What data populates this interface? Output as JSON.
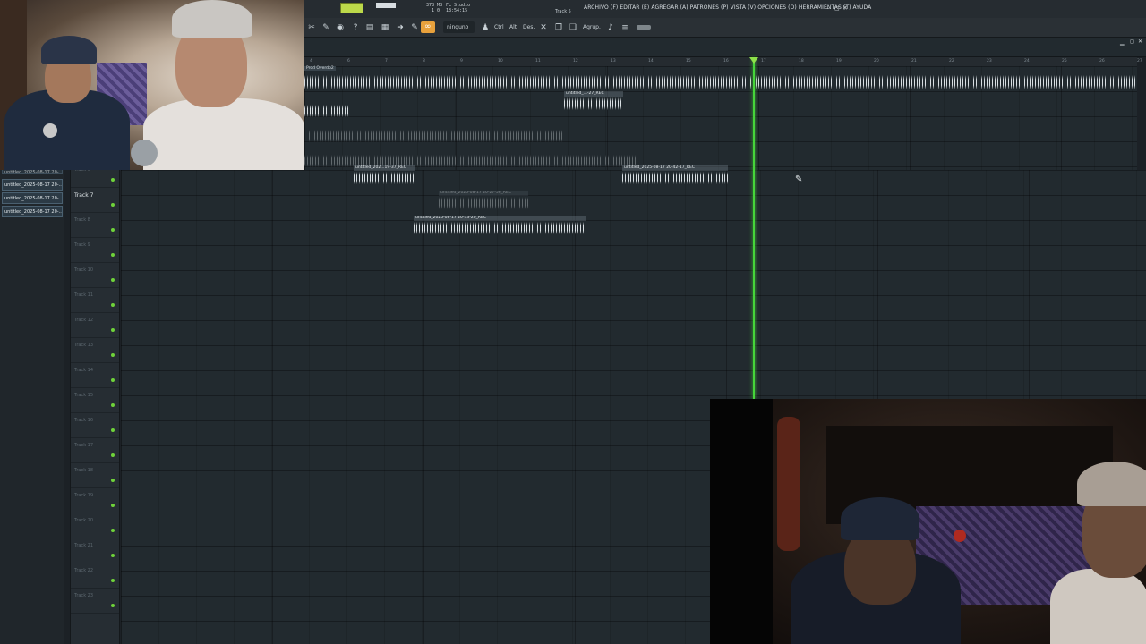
{
  "window": {
    "menu": "ARCHIVO (F) EDITAR (E) AGREGAR (A) PATRONES (P) VISTA (V) OPCIONES (O) HERRAMIENTAS (T) AYUDA",
    "track_label": "Track 5",
    "app_name": "FL Studio",
    "memory": "378 MB",
    "time": "18:54:15",
    "ratio": "1 0",
    "controls": [
      "–",
      "◻",
      "✕"
    ]
  },
  "toolbar": {
    "snap_label": "ninguno",
    "ctrl_label": "Ctrl",
    "alt_label": "Alt",
    "des_label": "Des.",
    "agrup_label": "Agrup."
  },
  "ruler": {
    "marks": [
      "4",
      "6",
      "7",
      "8",
      "9",
      "10",
      "11",
      "12",
      "13",
      "14",
      "15",
      "16",
      "17",
      "18",
      "19",
      "20",
      "21",
      "22",
      "23",
      "24",
      "25",
      "26",
      "27"
    ]
  },
  "playlist_header": "Prod Overdp2",
  "browser": {
    "items": [
      "untitled_2025-08-17 20-...",
      "untitled_2025-08-17 20-...",
      "untitled_2025-08-17 20-...",
      "untitled_2025-08-17 20-..."
    ]
  },
  "tracks": [
    {
      "name": "Track 6",
      "active": false
    },
    {
      "name": "Track 7",
      "active": true
    },
    {
      "name": "Track 8",
      "active": false
    },
    {
      "name": "Track 9",
      "active": false
    },
    {
      "name": "Track 10",
      "active": false
    },
    {
      "name": "Track 11",
      "active": false
    },
    {
      "name": "Track 12",
      "active": false
    },
    {
      "name": "Track 13",
      "active": false
    },
    {
      "name": "Track 14",
      "active": false
    },
    {
      "name": "Track 15",
      "active": false
    },
    {
      "name": "Track 16",
      "active": false
    },
    {
      "name": "Track 17",
      "active": false
    },
    {
      "name": "Track 18",
      "active": false
    },
    {
      "name": "Track 19",
      "active": false
    },
    {
      "name": "Track 20",
      "active": false
    },
    {
      "name": "Track 21",
      "active": false
    },
    {
      "name": "Track 22",
      "active": false
    },
    {
      "name": "Track 23",
      "active": false
    }
  ],
  "clips": [
    {
      "label": "untitled_...-27_REC"
    },
    {
      "label": "untitled_202...19-37_REC"
    },
    {
      "label": "untitled_2025-08-17 20-42-17_REC"
    },
    {
      "label": "untitled_2025-08-17 20-27-56_REC"
    },
    {
      "label": "untitled_2025-08-17 20-33-20_REC"
    }
  ],
  "colors": {
    "playhead": "#46d53a",
    "accent_orange": "#e8a13c",
    "meter_green": "#bcd94a",
    "background": "#222a2f"
  },
  "icons": {
    "cursor": "pointer-cursor-icon",
    "close": "close-icon",
    "minimize": "minimize-icon",
    "maximize": "maximize-icon"
  }
}
